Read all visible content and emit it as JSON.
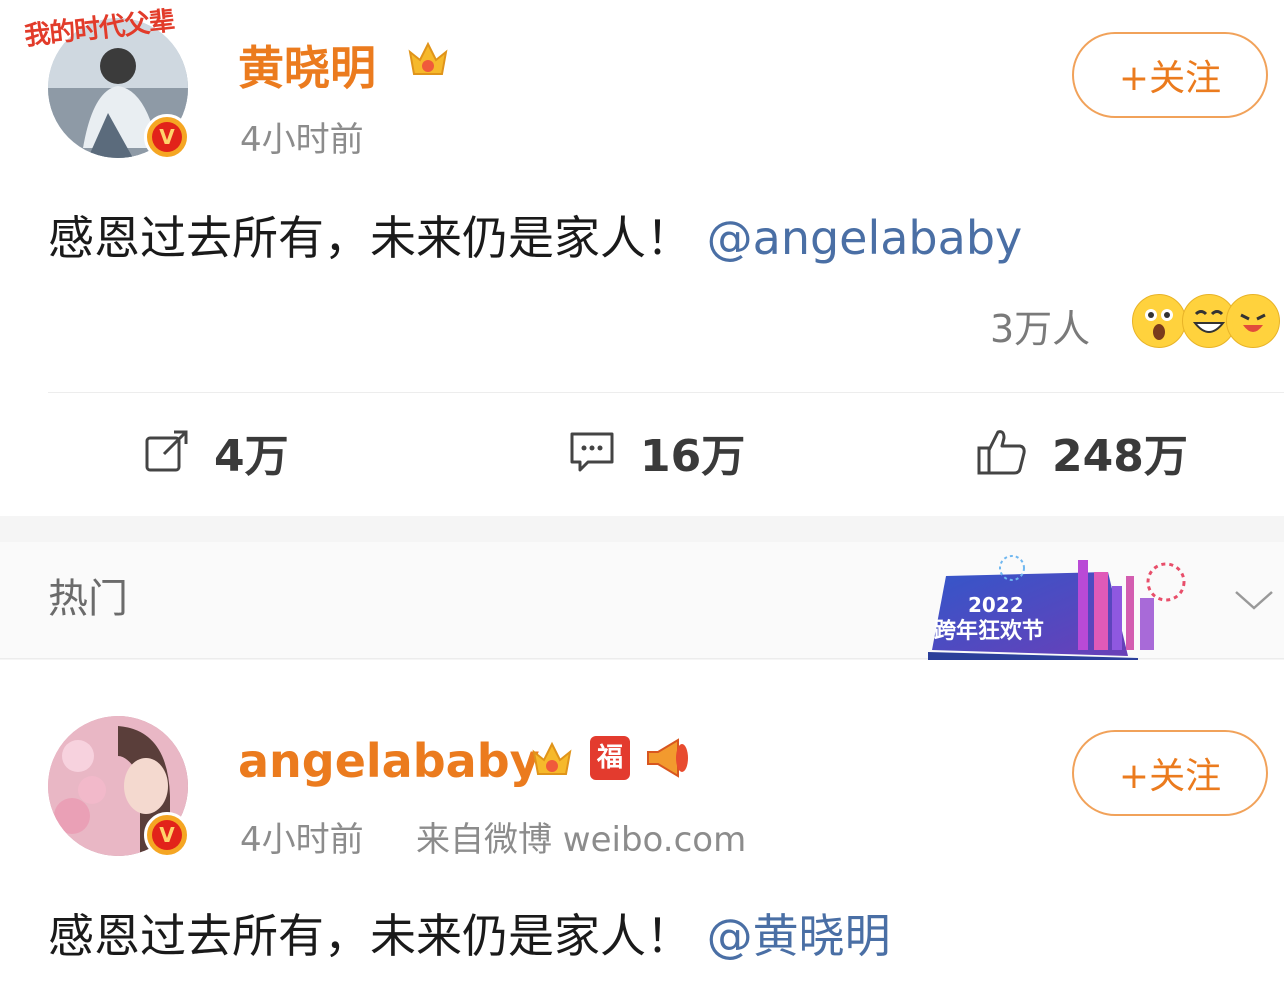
{
  "post1": {
    "avatar_frame_text": "我的时代父辈",
    "verified_mark": "V",
    "author": "黄晓明",
    "time": "4小时前",
    "follow_label": "+关注",
    "content_text": "感恩过去所有，未来仍是家人！",
    "mention": "@angelababy",
    "reaction_count": "3万人",
    "reaction_emojis": [
      "surprised-face-icon",
      "grinning-face-icon",
      "laughing-face-icon"
    ],
    "actions": {
      "repost_count": "4万",
      "comment_count": "16万",
      "like_count": "248万"
    }
  },
  "hot_section": {
    "label": "热门",
    "banner_year": "2022",
    "banner_title": "跨年狂欢节"
  },
  "post2": {
    "verified_mark": "V",
    "author": "angelababy",
    "badge_fu": "福",
    "time": "4小时前",
    "source": "来自微博 weibo.com",
    "follow_label": "+关注",
    "content_text": "感恩过去所有，未来仍是家人！",
    "mention": "@黄晓明"
  },
  "colors": {
    "accent_orange": "#eb7b1e",
    "mention_blue": "#4a6fa5",
    "verified_red": "#e2231a"
  }
}
